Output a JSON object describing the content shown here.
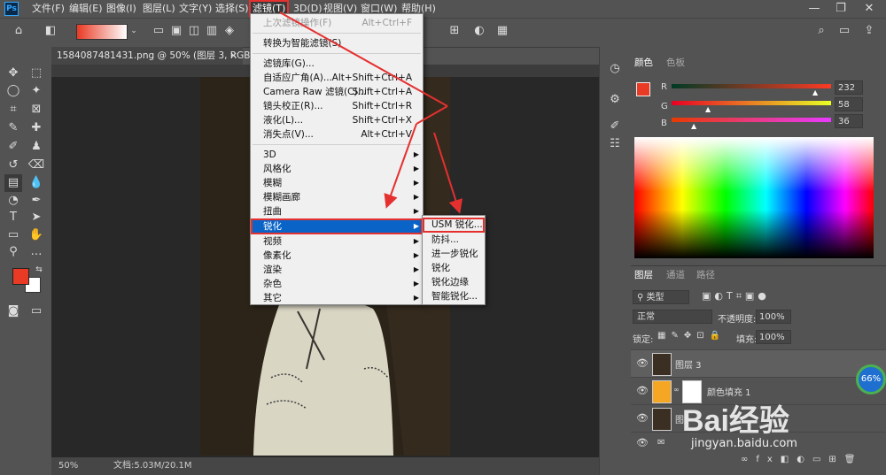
{
  "menubar": {
    "logo": "Ps",
    "items": [
      "文件(F)",
      "编辑(E)",
      "图像(I)",
      "图层(L)",
      "文字(Y)",
      "选择(S)",
      "滤镜(T)",
      "3D(D)",
      "视图(V)",
      "窗口(W)",
      "帮助(H)"
    ],
    "active_index": 6
  },
  "document": {
    "tab_title": "1584087481431.png @ 50% (图层 3, RGB/8) *",
    "close": "×",
    "zoom": "50%",
    "doc_size": "文档:5.03M/20.1M"
  },
  "filter_menu": {
    "items": [
      {
        "label": "上次滤镜操作(F)",
        "shortcut": "Alt+Ctrl+F",
        "disabled": true
      },
      {
        "label": "转换为智能滤镜(S)",
        "shortcut": ""
      },
      {
        "label": "滤镜库(G)...",
        "shortcut": ""
      },
      {
        "label": "自适应广角(A)...",
        "shortcut": "Alt+Shift+Ctrl+A"
      },
      {
        "label": "Camera Raw 滤镜(C)...",
        "shortcut": "Shift+Ctrl+A"
      },
      {
        "label": "镜头校正(R)...",
        "shortcut": "Shift+Ctrl+R"
      },
      {
        "label": "液化(L)...",
        "shortcut": "Shift+Ctrl+X"
      },
      {
        "label": "消失点(V)...",
        "shortcut": "Alt+Ctrl+V"
      },
      {
        "label": "3D",
        "submenu": true
      },
      {
        "label": "风格化",
        "submenu": true
      },
      {
        "label": "模糊",
        "submenu": true
      },
      {
        "label": "模糊画廊",
        "submenu": true
      },
      {
        "label": "扭曲",
        "submenu": true
      },
      {
        "label": "锐化",
        "submenu": true,
        "highlighted": true
      },
      {
        "label": "视频",
        "submenu": true
      },
      {
        "label": "像素化",
        "submenu": true
      },
      {
        "label": "渲染",
        "submenu": true
      },
      {
        "label": "杂色",
        "submenu": true
      },
      {
        "label": "其它",
        "submenu": true
      }
    ]
  },
  "sharpen_submenu": [
    "USM 锐化...",
    "防抖...",
    "进一步锐化",
    "锐化",
    "锐化边缘",
    "智能锐化..."
  ],
  "color_panel": {
    "tabs": [
      "颜色",
      "色板"
    ],
    "channels": [
      {
        "name": "R",
        "value": "232"
      },
      {
        "name": "G",
        "value": "58"
      },
      {
        "name": "B",
        "value": "36"
      }
    ],
    "foreground": "#e83a24"
  },
  "layers_panel": {
    "tabs": [
      "图层",
      "通道",
      "路径"
    ],
    "filter_kind": "类型",
    "blend_mode": "正常",
    "opacity_label": "不透明度:",
    "opacity_value": "100%",
    "lock_label": "锁定:",
    "fill_label": "填充:",
    "fill_value": "100%",
    "layers": [
      {
        "name": "图层 3"
      },
      {
        "name": "颜色填充 1"
      },
      {
        "name": "图"
      }
    ]
  },
  "overlay": {
    "progress": "66%",
    "watermark": "Bai经验",
    "watermark_url": "jingyan.baidu.com"
  },
  "colors": {
    "accent_red": "#e53030",
    "menu_highlight": "#0a64c8",
    "fill_layer_orange": "#f5a623"
  }
}
